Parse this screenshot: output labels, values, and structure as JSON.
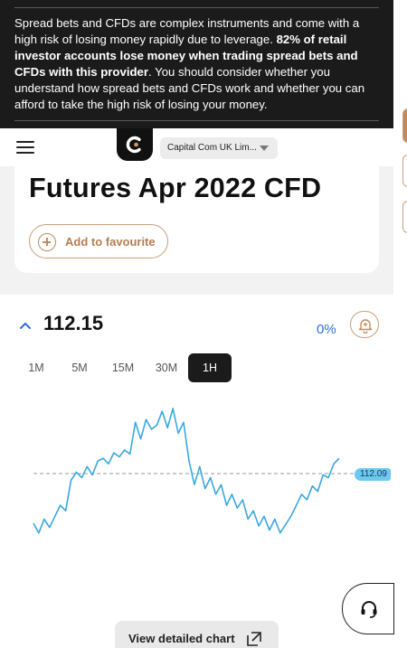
{
  "risk_warning": {
    "text_start": "Spread bets and CFDs are complex instruments and come with a high risk of losing money rapidly due to leverage. ",
    "text_bold": "82% of retail investor accounts lose money when trading spread bets and CFDs with this provider",
    "text_end": ". You should consider whether you understand how spread bets and CFDs work and whether you can afford to take the high risk of losing your money."
  },
  "header": {
    "menu_icon": "hamburger-icon",
    "logo_icon": "capital-com-logo",
    "account_select": "Capital Com UK Lim..."
  },
  "instrument": {
    "title": "Futures Apr 2022 CFD",
    "favourite_label": "Add to favourite"
  },
  "quote": {
    "price": "112.15",
    "change": "0%",
    "direction_icon": "chevron-up-icon",
    "alert_icon": "bell-plus-icon"
  },
  "timeframes": [
    {
      "label": "1M",
      "active": false
    },
    {
      "label": "5M",
      "active": false
    },
    {
      "label": "15M",
      "active": false
    },
    {
      "label": "30M",
      "active": false
    },
    {
      "label": "1H",
      "active": true
    }
  ],
  "chart_data": {
    "type": "line",
    "current_price_label": "112.09",
    "current_price_line": "dashed",
    "line_color": "#3aa7e0",
    "y_relative": [
      0.83,
      0.9,
      0.8,
      0.86,
      0.78,
      0.7,
      0.74,
      0.52,
      0.46,
      0.5,
      0.42,
      0.48,
      0.38,
      0.36,
      0.4,
      0.32,
      0.35,
      0.3,
      0.33,
      0.1,
      0.22,
      0.08,
      0.15,
      0.12,
      0.02,
      0.14,
      0.0,
      0.18,
      0.1,
      0.38,
      0.55,
      0.42,
      0.58,
      0.5,
      0.62,
      0.55,
      0.7,
      0.62,
      0.72,
      0.66,
      0.8,
      0.74,
      0.85,
      0.78,
      0.88,
      0.8,
      0.9,
      0.84,
      0.78,
      0.7,
      0.62,
      0.66,
      0.56,
      0.6,
      0.48,
      0.5,
      0.4,
      0.36
    ]
  },
  "actions": {
    "detail_chart_label": "View detailed chart",
    "support_icon": "headset-icon"
  }
}
